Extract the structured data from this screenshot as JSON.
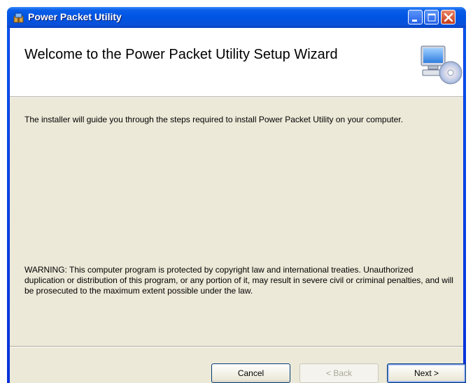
{
  "window": {
    "title": "Power Packet Utility",
    "icon": "installer-package-icon",
    "controls": [
      "minimize-icon",
      "maximize-icon",
      "close-icon"
    ]
  },
  "banner": {
    "title": "Welcome to the Power Packet Utility Setup Wizard",
    "icon": "computer-cd-icon"
  },
  "body": {
    "intro": "The installer will guide you through the steps required to install Power Packet Utility on your computer.",
    "warning": "WARNING: This computer program is protected by copyright law and international treaties. Unauthorized duplication or distribution of this program, or any portion of it, may result in severe civil or criminal penalties, and will be prosecuted to the maximum extent possible under the law."
  },
  "buttons": {
    "cancel": "Cancel",
    "back": "< Back",
    "next": "Next >"
  },
  "colors": {
    "titlebar": "#0054e3",
    "dialog_bg": "#ece9d8",
    "banner_bg": "#ffffff",
    "disabled_text": "#aca899"
  }
}
